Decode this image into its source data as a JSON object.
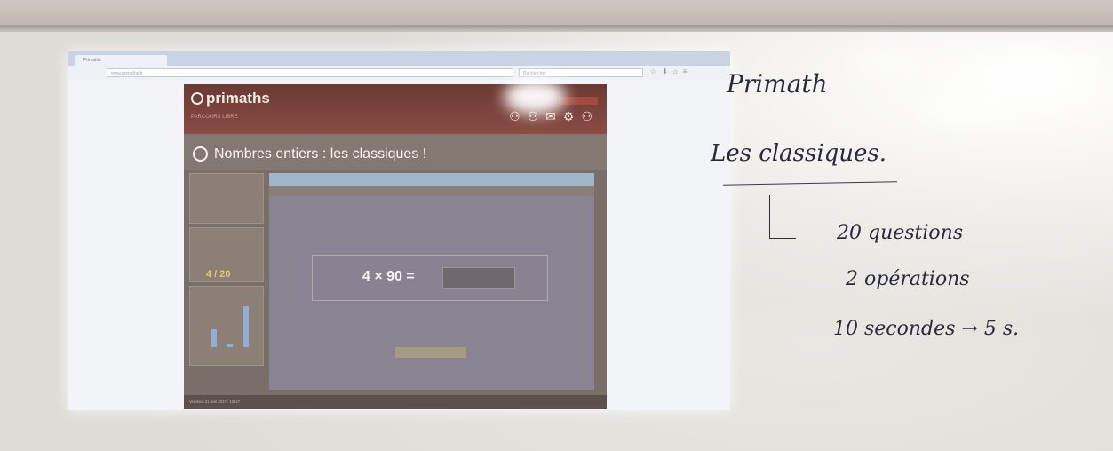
{
  "browser": {
    "tab_title": "Primaths",
    "url": "www.primaths.fr",
    "search_placeholder": "Rechercher"
  },
  "app": {
    "logo": "primaths",
    "section": "PARCOURS LIBRE",
    "title": "Nombres entiers : les classiques !",
    "score": "4 / 20",
    "question": "4 × 90 =",
    "answer_value": "",
    "footer_date": "Vendredi 21 avril 2017 - 13h47"
  },
  "board": {
    "line1": "Primath",
    "line2": "Les classiques.",
    "line3": "20 questions",
    "line4": "2 opérations",
    "line5": "10 secondes → 5 s."
  },
  "colors": {
    "header": "#7a4038",
    "panel": "#8a8392",
    "score": "#e7c971"
  }
}
